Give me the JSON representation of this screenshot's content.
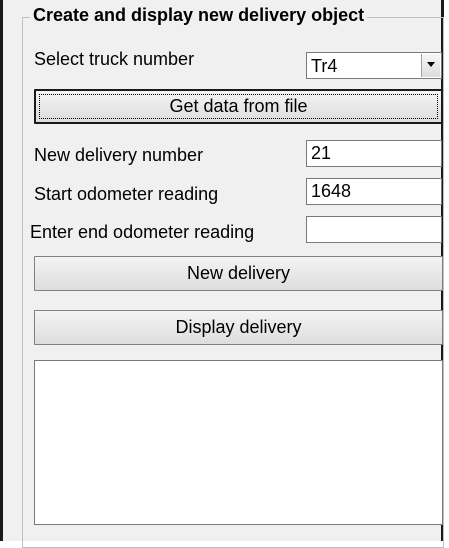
{
  "group": {
    "title": "Create and display new delivery object"
  },
  "truck": {
    "label": "Select truck number",
    "selected": "Tr4"
  },
  "get_data_button": "Get data from file",
  "delivery_number": {
    "label": "New delivery number",
    "value": "21"
  },
  "start_odometer": {
    "label": "Start odometer reading",
    "value": "1648"
  },
  "end_odometer": {
    "label": "Enter end odometer reading",
    "value": ""
  },
  "new_delivery_button": "New delivery",
  "display_delivery_button": "Display delivery",
  "output_list": {
    "items": []
  }
}
